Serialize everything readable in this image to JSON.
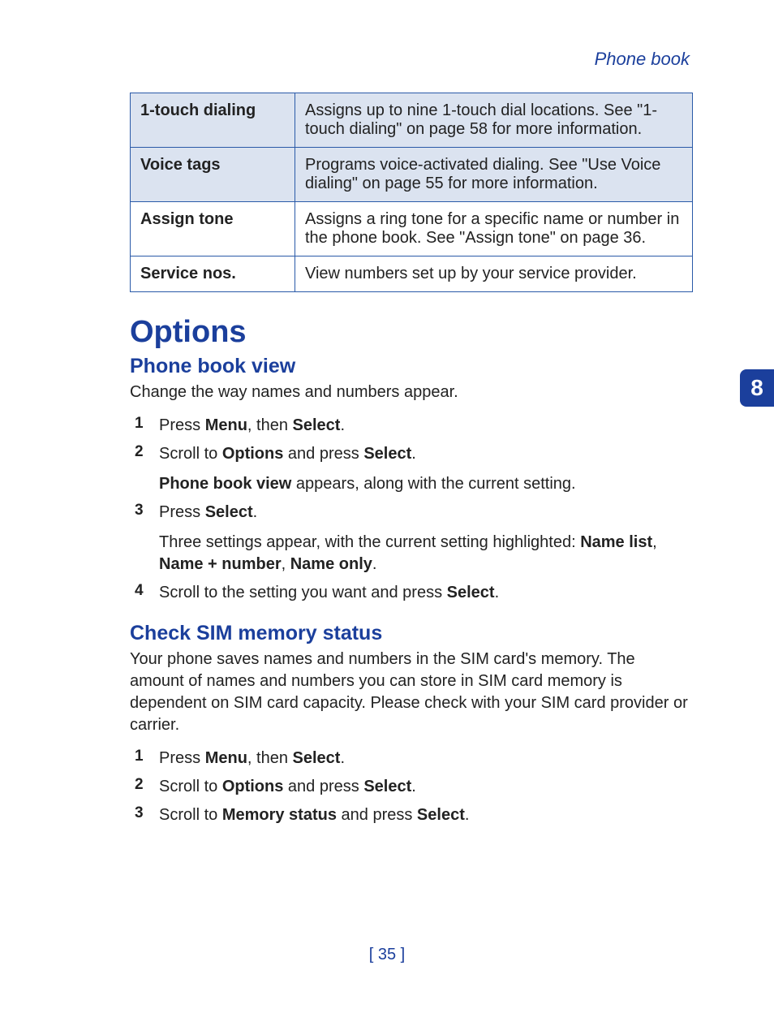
{
  "header": {
    "title": "Phone book"
  },
  "chapter_tab": "8",
  "page_number": "[ 35 ]",
  "table": {
    "rows": [
      {
        "label": "1-touch dialing",
        "desc": "Assigns up to nine 1-touch dial locations. See \"1-touch dialing\" on page 58 for more information.",
        "tint": true
      },
      {
        "label": "Voice tags",
        "desc": "Programs voice-activated dialing. See \"Use Voice dialing\" on page 55 for more information.",
        "tint": true
      },
      {
        "label": "Assign tone",
        "desc": "Assigns a ring tone for a specific name or number in the phone book. See \"Assign tone\" on page 36.",
        "tint": false
      },
      {
        "label": "Service nos.",
        "desc": "View numbers set up by your service provider.",
        "tint": false
      }
    ]
  },
  "sections": {
    "options_heading": "Options",
    "phone_book_view": {
      "heading": "Phone book view",
      "intro": "Change the way names and numbers appear.",
      "steps": [
        {
          "num": "1",
          "content": "Press <b>Menu</b>, then <b>Select</b>."
        },
        {
          "num": "2",
          "content": "Scroll to <b>Options</b> and press <b>Select</b>.",
          "sub": "<b>Phone book view</b> appears, along with the current setting."
        },
        {
          "num": "3",
          "content": "Press <b>Select</b>.",
          "sub": "Three settings appear, with the current setting highlighted: <b>Name list</b>, <b>Name + number</b>, <b>Name only</b>."
        },
        {
          "num": "4",
          "content": "Scroll to the setting you want and press <b>Select</b>."
        }
      ]
    },
    "check_sim": {
      "heading": "Check SIM memory status",
      "intro": "Your phone saves names and numbers in the SIM card's memory. The amount of names and numbers you can store in SIM card memory is dependent on SIM card capacity. Please check with your SIM card provider or carrier.",
      "steps": [
        {
          "num": "1",
          "content": "Press <b>Menu</b>, then <b>Select</b>."
        },
        {
          "num": "2",
          "content": "Scroll to <b>Options</b> and press <b>Select</b>."
        },
        {
          "num": "3",
          "content": "Scroll to <b>Memory status</b> and press <b>Select</b>."
        }
      ]
    }
  }
}
